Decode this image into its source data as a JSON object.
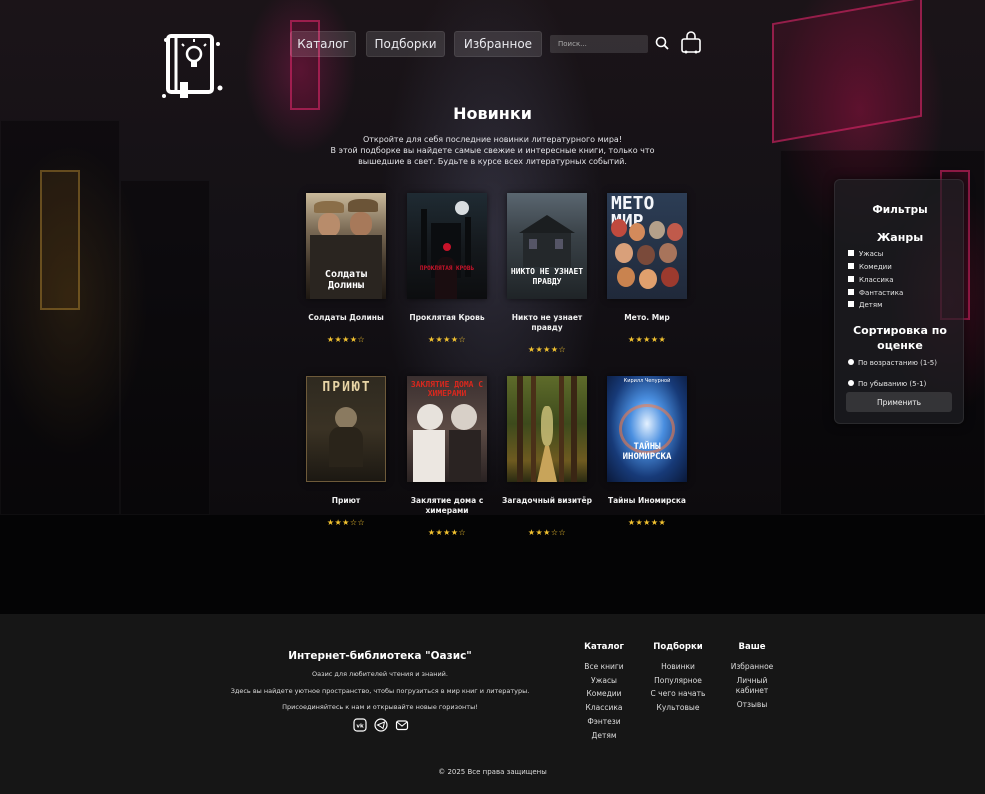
{
  "header": {
    "nav": [
      "Каталог",
      "Подборки",
      "Избранное"
    ],
    "search_placeholder": "Поиск..."
  },
  "hero": {
    "title": "Новинки",
    "description": [
      "Откройте для себя последние новинки литературного мира!",
      "В этой подборке вы найдете самые свежие и интересные книги, только что",
      "вышедшие в свет. Будьте в курсе всех литературных событий."
    ]
  },
  "books": [
    {
      "title": "Солдаты Долины",
      "stars": "★★★★☆",
      "cover_text": "Солдаты Долины"
    },
    {
      "title": "Проклятая Кровь",
      "stars": "★★★★☆",
      "cover_text": "ПРОКЛЯТАЯ КРОВЬ"
    },
    {
      "title": "Никто не узнает правду",
      "stars": "★★★★☆",
      "cover_text": "НИКТО НЕ УЗНАЕТ ПРАВДУ"
    },
    {
      "title": "Мето. Мир",
      "stars": "★★★★★",
      "cover_text": "МЕТО МИР"
    },
    {
      "title": "Приют",
      "stars": "★★★☆☆",
      "cover_text": "ПРИЮТ"
    },
    {
      "title": "Заклятие дома с химерами",
      "stars": "★★★★☆",
      "cover_text": "ЗАКЛЯТИЕ ДОМА С ХИМЕРАМИ"
    },
    {
      "title": "Загадочный визитёр",
      "stars": "★★★☆☆",
      "cover_text": ""
    },
    {
      "title": "Тайны Иномирска",
      "stars": "★★★★★",
      "cover_text": "ТАЙНЫ ИНОМИРСКА",
      "cover_author": "Кирилл Чепурной"
    }
  ],
  "filters": {
    "title": "Фильтры",
    "genres_title": "Жанры",
    "genres": [
      "Ужасы",
      "Комедии",
      "Классика",
      "Фантастика",
      "Детям"
    ],
    "sort_title_line1": "Сортировка по",
    "sort_title_line2": "оценке",
    "sort_options": [
      "По возрастанию (1-5)",
      "По убыванию (5-1)"
    ],
    "apply_label": "Применить"
  },
  "footer": {
    "title": "Интернет-библиотека \"Оазис\"",
    "lines": [
      "Оазис для любителей чтения и знаний.",
      "Здесь вы найдете уютное пространство, чтобы погрузиться в мир книг и литературы.",
      "Присоединяйтесь к нам и открывайте новые горизонты!"
    ],
    "columns": [
      {
        "head": "Каталог",
        "links": [
          "Все книги",
          "Ужасы",
          "Комедии",
          "Классика",
          "Фэнтези",
          "Детям"
        ]
      },
      {
        "head": "Подборки",
        "links": [
          "Новинки",
          "Популярное",
          "С чего начать",
          "Культовые"
        ]
      },
      {
        "head": "Ваше",
        "links": [
          "Избранное",
          "Личный",
          "кабинет",
          "Отзывы"
        ]
      }
    ],
    "copyright": "© 2025 Все права защищены"
  }
}
